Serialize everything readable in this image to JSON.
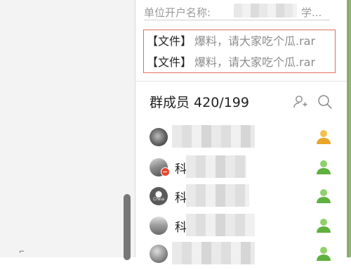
{
  "group_notice": {
    "label": "单位开户名称:",
    "suffix": "学..."
  },
  "files": [
    {
      "tag": "【文件】",
      "name": "爆料，请大家吃个瓜.rar"
    },
    {
      "tag": "【文件】",
      "name": "爆料，请大家吃个瓜.rar"
    }
  ],
  "members_header": {
    "title": "群成员 420/199"
  },
  "members": [
    {
      "name": "",
      "role": "owner",
      "role_color": "#e8b23a"
    },
    {
      "name": "科",
      "role": "member",
      "role_color": "#6cbf4a"
    },
    {
      "name": "科",
      "role": "member",
      "role_color": "#6cbf4a",
      "avatar_text": "China"
    },
    {
      "name": "科",
      "role": "member",
      "role_color": "#6cbf4a"
    },
    {
      "name": "",
      "role": "member",
      "role_color": "#6cbf4a"
    }
  ],
  "icons": {
    "add_member": "add-member-icon",
    "search": "search-icon"
  },
  "colors": {
    "file_box_border": "#e06e5c",
    "owner": "#e8b23a",
    "member": "#6cbf4a"
  }
}
